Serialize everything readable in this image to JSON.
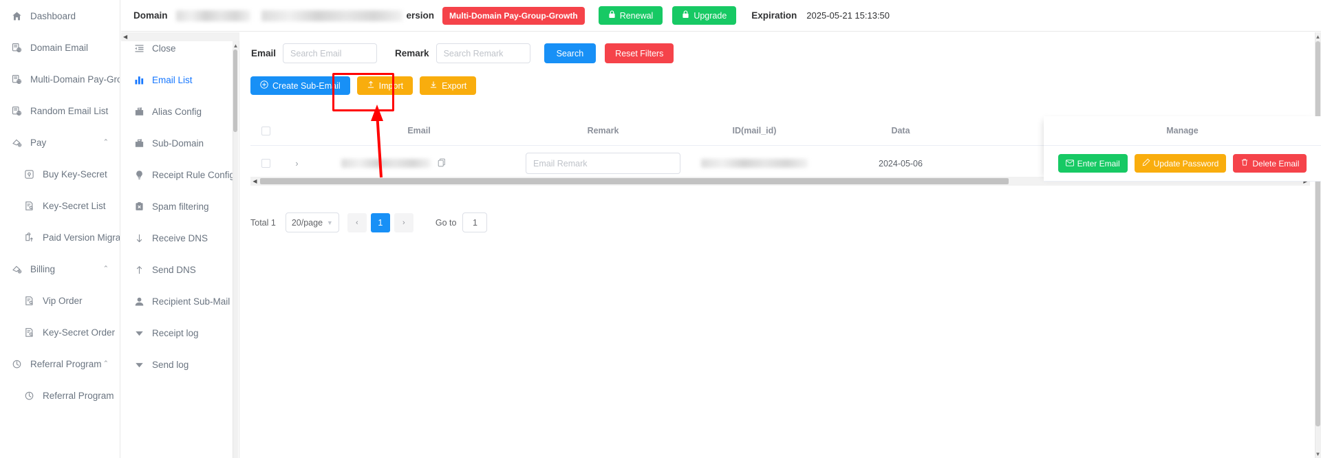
{
  "left_sidebar": {
    "items": [
      {
        "label": "Dashboard",
        "icon": "home-icon",
        "type": "item"
      },
      {
        "label": "Domain Email",
        "icon": "domain-email-icon",
        "type": "item"
      },
      {
        "label": "Multi-Domain Pay-Group",
        "icon": "domain-email-icon",
        "type": "item"
      },
      {
        "label": "Random Email List",
        "icon": "domain-email-icon",
        "type": "item"
      },
      {
        "label": "Pay",
        "icon": "pay-icon",
        "type": "group",
        "caret": "⌃"
      },
      {
        "label": "Buy Key-Secret",
        "icon": "buy-key-icon",
        "type": "sub"
      },
      {
        "label": "Key-Secret List",
        "icon": "list-doc-icon",
        "type": "sub"
      },
      {
        "label": "Paid Version Migration",
        "icon": "migration-icon",
        "type": "sub"
      },
      {
        "label": "Billing",
        "icon": "pay-icon",
        "type": "group",
        "caret": "⌃"
      },
      {
        "label": "Vip Order",
        "icon": "list-doc-icon",
        "type": "sub"
      },
      {
        "label": "Key-Secret Order",
        "icon": "list-doc-icon",
        "type": "sub"
      },
      {
        "label": "Referral Program",
        "icon": "referral-icon",
        "type": "group",
        "caret": "⌃"
      },
      {
        "label": "Referral Program",
        "icon": "referral-icon",
        "type": "sub"
      }
    ]
  },
  "inner_sidebar": {
    "items": [
      {
        "label": "Close",
        "icon": "collapse-menu-icon",
        "active": false
      },
      {
        "label": "Email List",
        "icon": "bar-chart-icon",
        "active": true
      },
      {
        "label": "Alias Config",
        "icon": "briefcase-icon",
        "active": false
      },
      {
        "label": "Sub-Domain",
        "icon": "briefcase-icon",
        "active": false
      },
      {
        "label": "Receipt Rule Config",
        "icon": "bulb-icon",
        "active": false
      },
      {
        "label": "Spam filtering",
        "icon": "spam-icon",
        "active": false
      },
      {
        "label": "Receive DNS",
        "icon": "arrow-down-icon",
        "active": false
      },
      {
        "label": "Send DNS",
        "icon": "arrow-up-icon",
        "active": false
      },
      {
        "label": "Recipient Sub-Mail",
        "icon": "user-icon",
        "active": false
      },
      {
        "label": "Receipt log",
        "icon": "triangle-down-icon",
        "active": false
      },
      {
        "label": "Send log",
        "icon": "triangle-down-icon",
        "active": false
      }
    ]
  },
  "header": {
    "domain_label": "Domain",
    "version_label": "ersion",
    "plan_badge": "Multi-Domain Pay-Group-Growth",
    "renewal_button": "Renewal",
    "upgrade_button": "Upgrade",
    "expiration_label": "Expiration",
    "expiration_value": "2025-05-21 15:13:50"
  },
  "filters": {
    "email_label": "Email",
    "email_placeholder": "Search Email",
    "email_value": "",
    "remark_label": "Remark",
    "remark_placeholder": "Search Remark",
    "remark_value": "",
    "search_button": "Search",
    "reset_button": "Reset Filters"
  },
  "actions": {
    "create": "Create Sub-Email",
    "import": "Import",
    "export": "Export"
  },
  "table": {
    "columns": [
      "Email",
      "Remark",
      "ID(mail_id)",
      "Data",
      "Manage"
    ],
    "row": {
      "remark_placeholder": "Email Remark",
      "remark_value": "",
      "date": "2024-05-06",
      "enter_email": "Enter Email",
      "update_password": "Update Password",
      "delete_email": "Delete Email"
    }
  },
  "pagination": {
    "total_label": "Total 1",
    "page_size": "20/page",
    "prev": "‹",
    "current_page": "1",
    "next": "›",
    "goto_label": "Go to",
    "goto_value": "1"
  },
  "colors": {
    "primary_blue": "#1890f6",
    "danger_red": "#f5434a",
    "success_green": "#17c964",
    "warning_orange": "#f9ad0d",
    "annotation_red": "#ff0000"
  }
}
